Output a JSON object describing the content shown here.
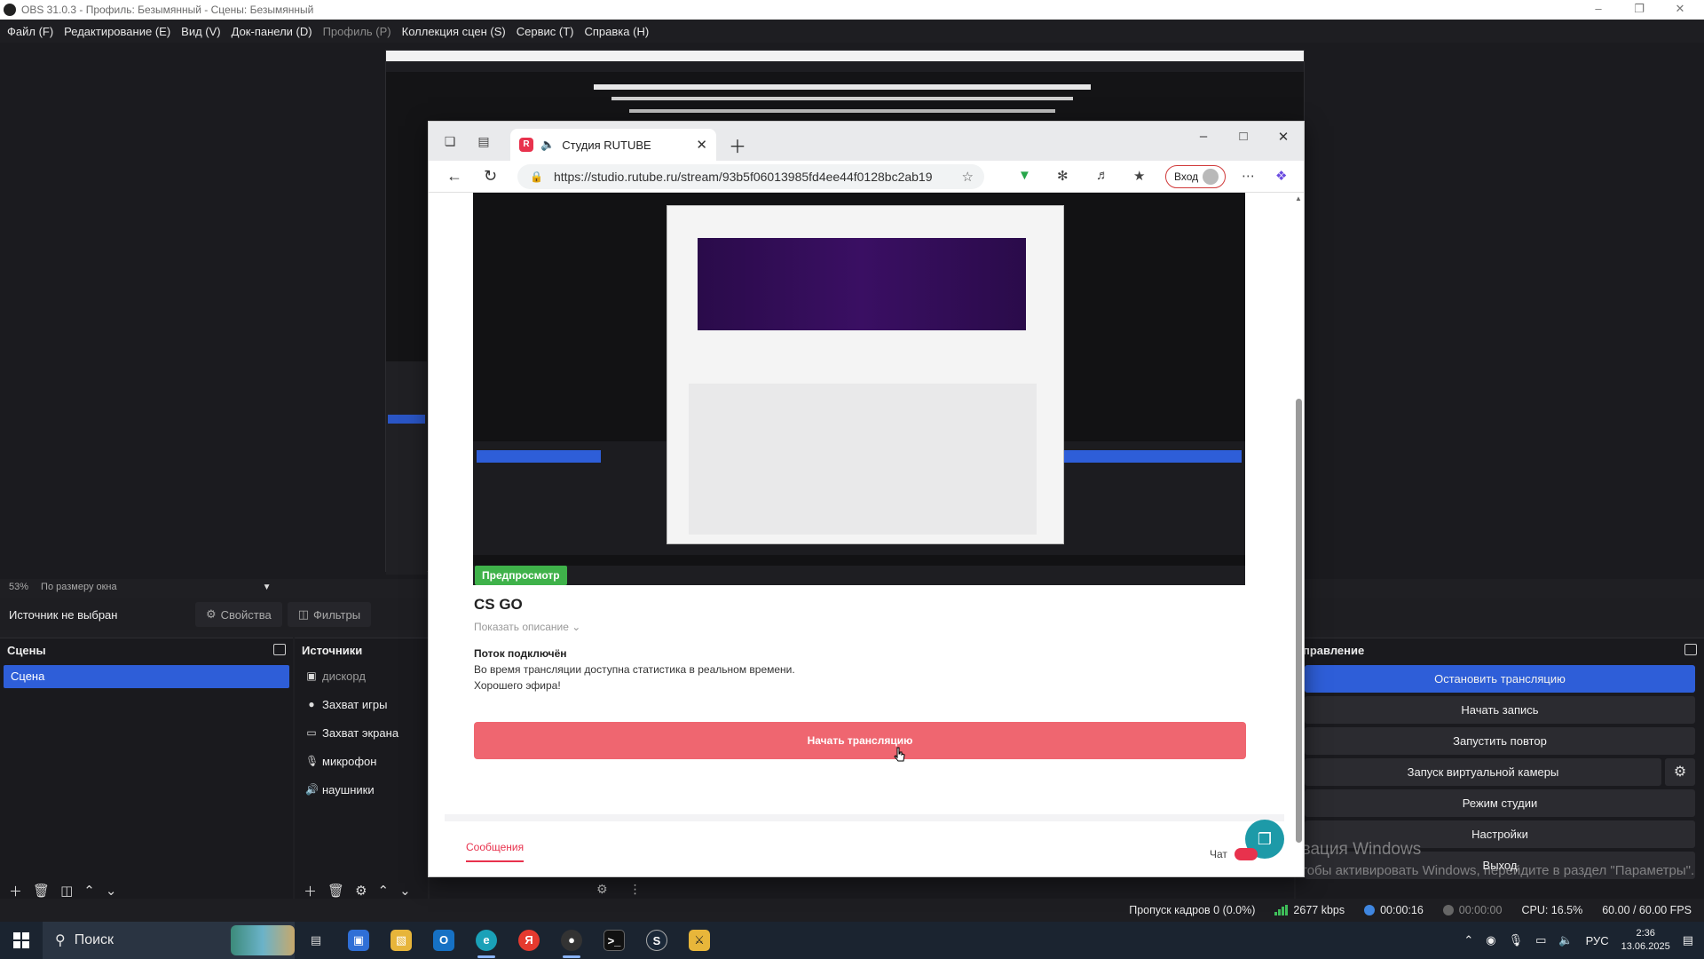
{
  "obs": {
    "title": "OBS 31.0.3 - Профиль: Безымянный - Сцены: Безымянный",
    "menu": [
      "Файл (F)",
      "Редактирование (E)",
      "Вид (V)",
      "Док-панели (D)",
      "Профиль (P)",
      "Коллекция сцен (S)",
      "Сервис (T)",
      "Справка (H)"
    ],
    "zoom": "53%",
    "zoom_mode": "По размеру окна",
    "no_source": "Источник не выбран",
    "properties_label": "Свойства",
    "filters_label": "Фильтры",
    "scenes_title": "Сцены",
    "scene_item": "Сцена",
    "sources_title": "Источники",
    "sources": [
      "дискорд",
      "Захват игры",
      "Захват экрана",
      "микрофон",
      "наушники"
    ],
    "controls_title": "правление",
    "controls": {
      "stop_stream": "Остановить трансляцию",
      "start_record": "Начать запись",
      "start_replay": "Запустить повтор",
      "virtual_cam": "Запуск виртуальной камеры",
      "studio_mode": "Режим студии",
      "settings": "Настройки",
      "exit": "Выход"
    },
    "status": {
      "dropped": "Пропуск кадров 0 (0.0%)",
      "bitrate": "2677 kbps",
      "stream_time": "00:00:16",
      "rec_time": "00:00:00",
      "cpu": "CPU: 16.5%",
      "fps": "60.00 / 60.00 FPS"
    },
    "watermark_1": "ивация Windows",
    "watermark_2": "Чтобы активировать Windows, перейдите в раздел \"Параметры\"."
  },
  "browser": {
    "tab_title": "Студия RUTUBE",
    "url": "https://studio.rutube.ru/stream/93b5f06013985fd4ee44f0128bc2ab19",
    "signin": "Вход"
  },
  "page": {
    "preview_badge": "Предпросмотр",
    "stream_title": "CS GO",
    "show_description": "Показать описание",
    "status_heading": "Поток подключён",
    "info_line1": "Во время трансляции доступна статистика в реальном времени.",
    "info_line2": "Хорошего эфира!",
    "start_button": "Начать трансляцию",
    "messages_tab": "Сообщения",
    "chat_label": "Чат"
  },
  "taskbar": {
    "search": "Поиск",
    "lang": "РУС",
    "time": "2:36",
    "date": "13.06.2025"
  },
  "colors": {
    "obs_accent": "#2e5ed8",
    "rutube_red": "#e8324d",
    "start_button": "#ef6670",
    "preview_badge": "#3fb24a"
  }
}
